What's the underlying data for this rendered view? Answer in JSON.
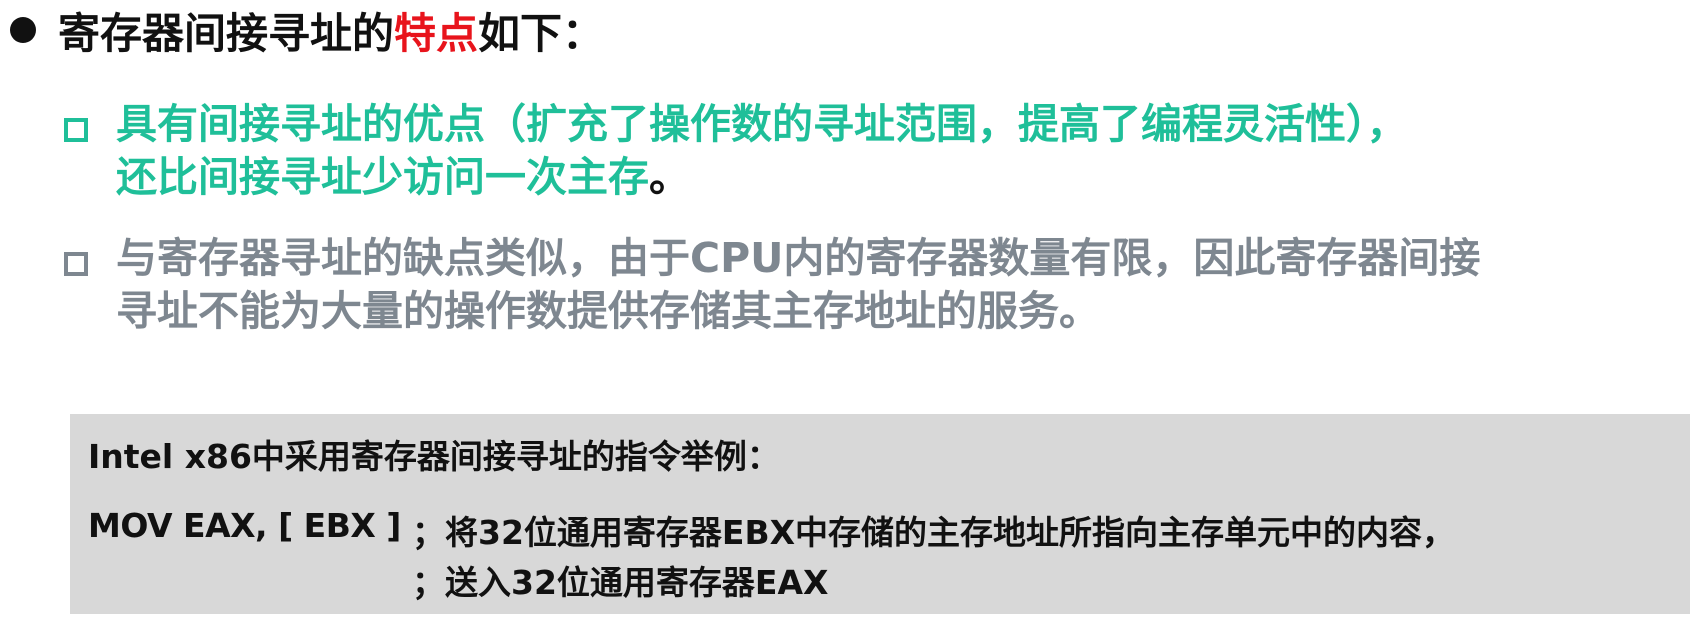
{
  "heading": {
    "prefix": "寄存器间接寻址的",
    "accent": "特点",
    "suffix": "如下："
  },
  "points": [
    {
      "line1": "具有间接寻址的优点（扩充了操作数的寻址范围，提高了编程灵活性），",
      "line2": "还比间接寻址少访问一次主存",
      "tail": "。"
    },
    {
      "line1": "与寄存器寻址的缺点类似，由于CPU内的寄存器数量有限，因此寄存器间接",
      "line2": "寻址不能为大量的操作数提供存储其主存地址的服务。"
    }
  ],
  "example": {
    "title": "Intel x86中采用寄存器间接寻址的指令举例：",
    "code": "MOV  EAX, [ EBX ]",
    "comment_line1": "；将32位通用寄存器EBX中存储的主存地址所指向主存单元中的内容，",
    "comment_line2": "；送入32位通用寄存器EAX"
  },
  "colors": {
    "accent_red": "#e8141c",
    "teal": "#1fbf99",
    "gray_text": "#7e8790",
    "example_bg": "#d8d8d8"
  }
}
